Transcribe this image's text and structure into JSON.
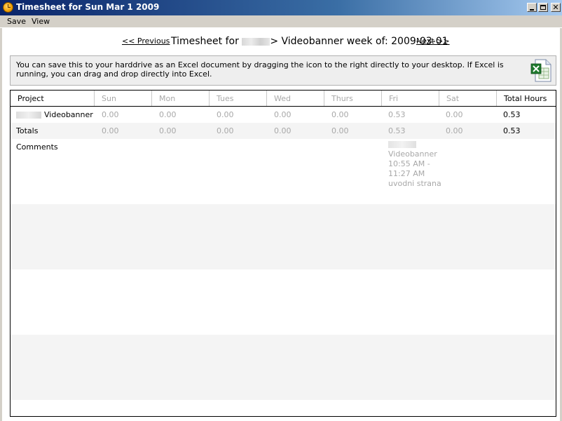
{
  "window": {
    "title": "Timesheet for Sun Mar 1 2009",
    "controls": {
      "minimize": "_",
      "maximize": "□",
      "close": "✕"
    }
  },
  "menu": {
    "items": [
      "Save",
      "View"
    ]
  },
  "nav": {
    "previous_label": "<< Previous",
    "title_prefix": "Timesheet for",
    "title_suffix": "> Videobanner week of: 2009-03-01",
    "next_label": "Next >>"
  },
  "info": {
    "text": "You can save this to your harddrive as an Excel document by dragging the icon to the right directly to your desktop. If Excel is running, you can drag and drop directly into Excel.",
    "icon": "excel-file-icon"
  },
  "table": {
    "headers": [
      "Project",
      "Sun",
      "Mon",
      "Tues",
      "Wed",
      "Thurs",
      "Fri",
      "Sat",
      "Total Hours"
    ],
    "project_row": {
      "project": "Videobanner",
      "values": [
        "0.00",
        "0.00",
        "0.00",
        "0.00",
        "0.00",
        "0.53",
        "0.00"
      ],
      "total": "0.53"
    },
    "totals_row": {
      "label": "Totals",
      "values": [
        "0.00",
        "0.00",
        "0.00",
        "0.00",
        "0.00",
        "0.53",
        "0.00"
      ],
      "total": "0.53"
    },
    "comments": {
      "label": "Comments",
      "fri_lines": [
        "Videobanner",
        "10:55 AM -",
        "11:27 AM",
        "uvodni strana"
      ]
    }
  }
}
